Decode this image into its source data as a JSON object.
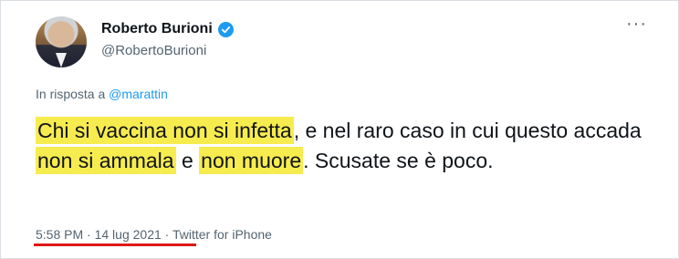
{
  "author": {
    "name": "Roberto Burioni",
    "handle": "@RobertoBurioni",
    "verified_icon": "verified-badge-icon",
    "avatar_icon": "profile-photo"
  },
  "menu": {
    "more_label": "···"
  },
  "reply": {
    "prefix": "In risposta a ",
    "mention": "@marattin"
  },
  "tweet": {
    "h1": "Chi si vaccina non si infetta",
    "t1": ", e nel raro caso in cui questo accada ",
    "h2": "non si ammala",
    "t2": " e ",
    "h3": "non muore",
    "t3": ". Scusate se è poco."
  },
  "meta": {
    "time": "5:58 PM",
    "sep1": " · ",
    "date": "14 lug 2021",
    "sep2": " · ",
    "source": "Twitter for iPhone"
  },
  "colors": {
    "highlight": "#f7ec4f",
    "underline": "#e01818",
    "accent": "#1d9bf0"
  }
}
